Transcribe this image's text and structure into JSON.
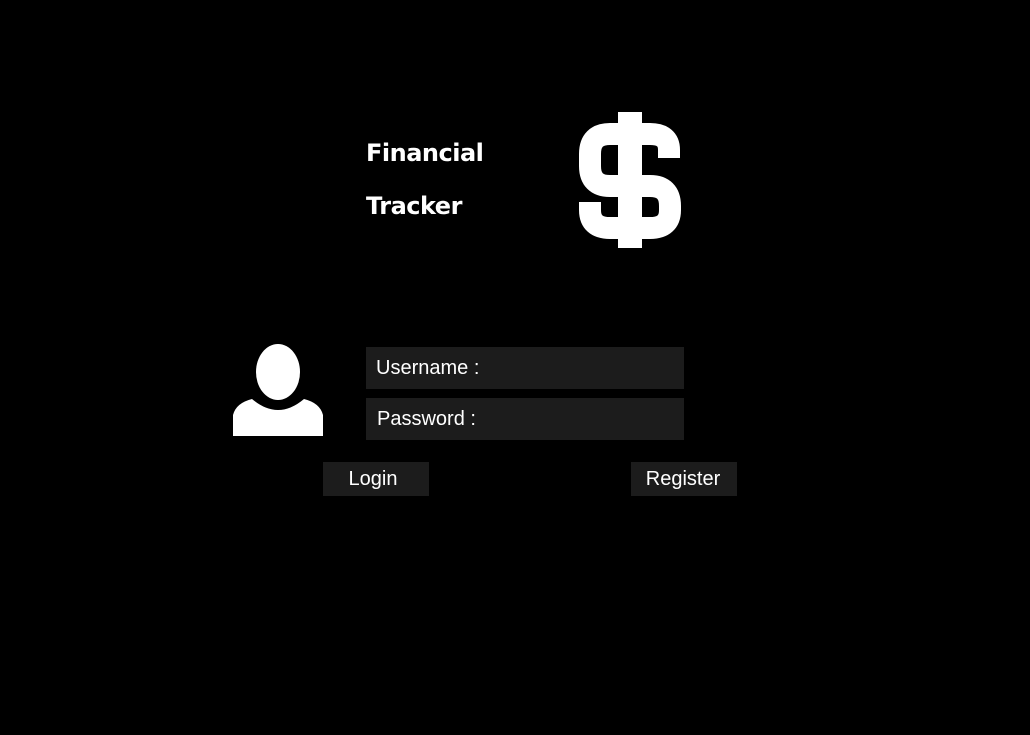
{
  "app": {
    "title_line_1": "Financial",
    "title_line_2": "Tracker",
    "logo_icon": "dollar-sign-icon"
  },
  "form": {
    "avatar_icon": "user-silhouette-icon",
    "username_label": "Username :",
    "password_label": "Password :",
    "login_label": "Login",
    "register_label": "Register"
  },
  "colors": {
    "background": "#000000",
    "field_background": "#1c1c1c",
    "text": "#ffffff"
  }
}
